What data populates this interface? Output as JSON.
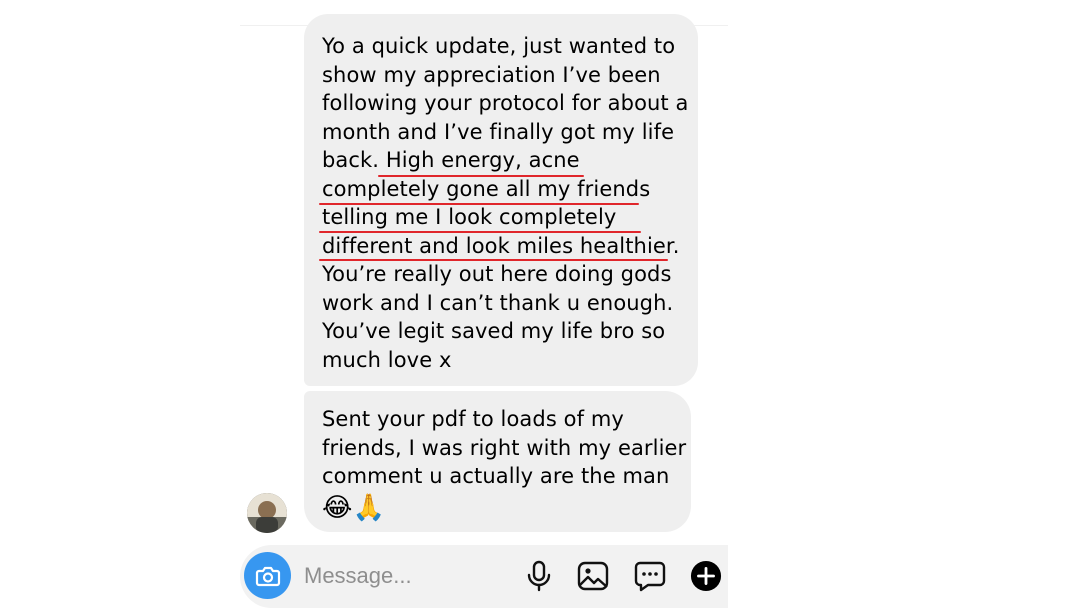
{
  "thread": {
    "messages": [
      {
        "lines": [
          "Yo a quick update, just wanted to",
          "show my appreciation I’ve been",
          "following your protocol for about a",
          "month and I’ve finally got my life",
          "back. High energy, acne",
          "completely gone all my friends",
          "telling me I look completely",
          "different and look miles healthier.",
          "You’re really out here doing gods",
          "work and I can’t thank u enough.",
          "You’ve legit saved my life bro so",
          "much love x"
        ]
      },
      {
        "lines": [
          "Sent your pdf to loads of my",
          "friends, I was right with my earlier",
          "comment u actually are the man"
        ],
        "emoji": "😂🙏"
      }
    ]
  },
  "composer": {
    "placeholder": "Message..."
  },
  "colors": {
    "bubble": "#efefef",
    "accent": "#3797f0",
    "underline": "#e0262b",
    "placeholder": "#8e8e8e"
  },
  "icons": {
    "camera": "camera-icon",
    "mic": "microphone-icon",
    "gallery": "image-icon",
    "sticker": "chat-bubble-icon",
    "add": "plus-circle-icon"
  }
}
